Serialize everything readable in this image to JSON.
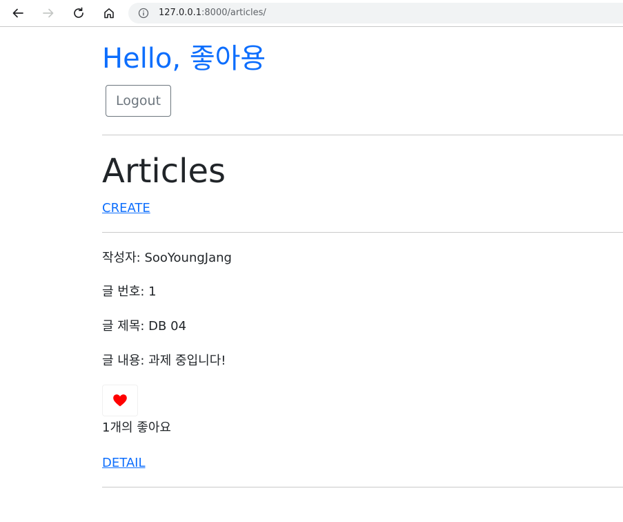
{
  "browser": {
    "url_host": "127.0.0.1",
    "url_rest": ":8000/articles/"
  },
  "header": {
    "greeting": "Hello, 좋아용",
    "logout_label": "Logout"
  },
  "main": {
    "title": "Articles",
    "create_label": "CREATE"
  },
  "article": {
    "author_line": "작성자: SooYoungJang",
    "number_line": "글 번호: 1",
    "title_line": "글 제목: DB 04",
    "content_line": "글 내용: 과제 중입니다!",
    "like_icon": "heart-icon",
    "like_color": "#ff0000",
    "likes_line": "1개의 좋아요",
    "detail_label": "DETAIL"
  },
  "colors": {
    "link": "#0d6efd",
    "text": "#212529",
    "muted": "#6c757d"
  }
}
